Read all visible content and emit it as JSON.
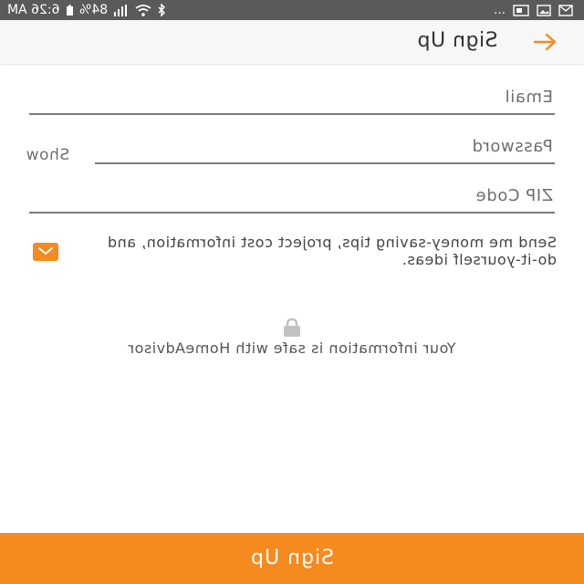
{
  "status_bar": {
    "time": "6:26 AM",
    "battery": "84%",
    "more": "…"
  },
  "app_bar": {
    "title": "Sign Up"
  },
  "form": {
    "email_placeholder": "Email",
    "password_placeholder": "Password",
    "show_label": "Show",
    "zip_placeholder": "ZIP Code",
    "consent_checked": true,
    "consent_text": "Send me money-saving tips, project cost information, and do-it-yourself ideas."
  },
  "safe": {
    "text": "Your information is safe with HomeAdvisor"
  },
  "footer": {
    "signup_label": "Sign Up"
  },
  "colors": {
    "accent": "#f58a1f",
    "status_bar": "#5a5a5a",
    "app_bar": "#f7f7f7"
  },
  "icons": {
    "back": "arrow-back-icon",
    "lock": "lock-icon",
    "check": "checkbox-checked-icon"
  }
}
